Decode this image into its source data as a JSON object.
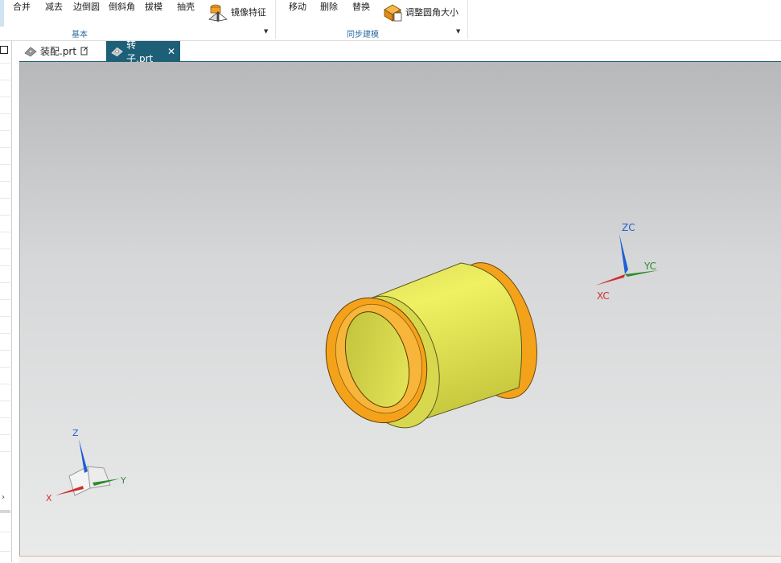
{
  "ribbon": {
    "basic_group": {
      "buttons": [
        "合并",
        "减去",
        "边倒圆",
        "倒斜角",
        "拔模",
        "抽壳"
      ],
      "mirror_feature": "镜像特征",
      "label": "基本",
      "dropdown_icon": "dropdown-arrow-icon"
    },
    "sync_group": {
      "buttons": [
        "移动",
        "删除",
        "替换"
      ],
      "resize_blend": "调整圆角大小",
      "label": "同步建模",
      "dropdown_icon": "dropdown-arrow-icon"
    }
  },
  "tabs": [
    {
      "label": "装配.prt",
      "icon": "assembly-part-icon",
      "suffix_icon": "modified-doc-icon",
      "active": false
    },
    {
      "label": "转子.prt",
      "icon": "part-icon",
      "close_icon": "close-icon",
      "active": true
    }
  ],
  "viewport": {
    "wcs_labels": {
      "x": "XC",
      "y": "YC",
      "z": "ZC"
    },
    "absolute_triad_labels": {
      "x": "X",
      "y": "Y",
      "z": "Z"
    },
    "colors": {
      "x_axis": "#d22f2f",
      "y_axis": "#2e8b2e",
      "z_axis": "#1f5fd6",
      "cylinder_body": "#e6e850",
      "cylinder_ends": "#f5a21b"
    }
  }
}
